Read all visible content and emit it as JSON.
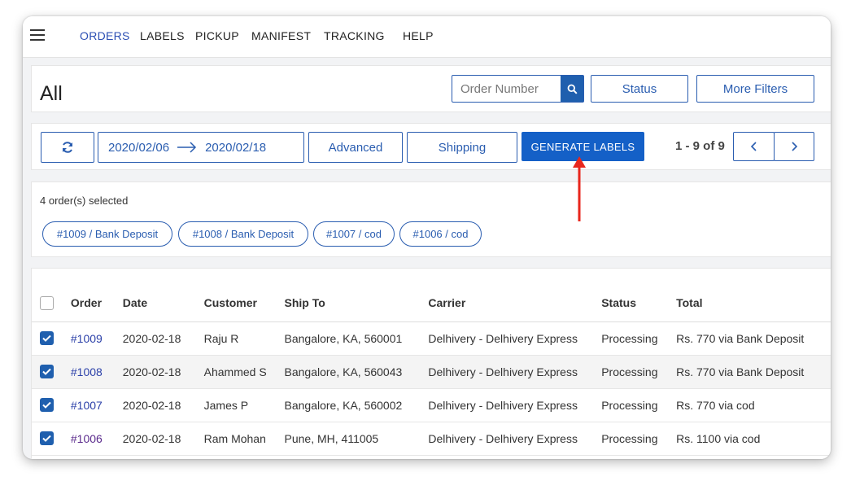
{
  "nav": {
    "menu_icon": "hamburger-menu-icon",
    "items": [
      {
        "label": "ORDERS",
        "active": true
      },
      {
        "label": "LABELS",
        "active": false
      },
      {
        "label": "PICKUP",
        "active": false
      },
      {
        "label": "MANIFEST",
        "active": false
      },
      {
        "label": "TRACKING",
        "active": false
      },
      {
        "label": "HELP",
        "active": false
      }
    ]
  },
  "header": {
    "title": "All",
    "search": {
      "placeholder": "Order Number",
      "value": "",
      "icon": "search-icon"
    },
    "status_label": "Status",
    "more_filters_label": "More Filters"
  },
  "toolbar": {
    "refresh_icon": "refresh-icon",
    "date_from": "2020/02/06",
    "date_to": "2020/02/18",
    "advanced_label": "Advanced",
    "shipping_label": "Shipping",
    "generate_labels_label": "GENERATE LABELS",
    "pager_text": "1 - 9 of 9",
    "prev_icon": "chevron-left-icon",
    "next_icon": "chevron-right-icon"
  },
  "selection": {
    "summary": "4 order(s) selected",
    "chips": [
      "#1009 / Bank Deposit",
      "#1008 / Bank Deposit",
      "#1007 / cod",
      "#1006 / cod"
    ]
  },
  "table": {
    "columns": [
      "Order",
      "Date",
      "Customer",
      "Ship To",
      "Carrier",
      "Status",
      "Total"
    ],
    "rows": [
      {
        "checked": true,
        "order": "#1009",
        "date": "2020-02-18",
        "customer": "Raju R",
        "ship_to": "Bangalore, KA, 560001",
        "carrier": "Delhivery - Delhivery Express",
        "status": "Processing",
        "total": "Rs. 770 via Bank Deposit"
      },
      {
        "checked": true,
        "order": "#1008",
        "date": "2020-02-18",
        "customer": "Ahammed S",
        "ship_to": "Bangalore, KA, 560043",
        "carrier": "Delhivery - Delhivery Express",
        "status": "Processing",
        "total": "Rs. 770 via Bank Deposit"
      },
      {
        "checked": true,
        "order": "#1007",
        "date": "2020-02-18",
        "customer": "James P",
        "ship_to": "Bangalore, KA, 560002",
        "carrier": "Delhivery - Delhivery Express",
        "status": "Processing",
        "total": "Rs. 770 via cod"
      },
      {
        "checked": true,
        "order": "#1006",
        "date": "2020-02-18",
        "customer": "Ram Mohan",
        "ship_to": "Pune, MH, 411005",
        "carrier": "Delhivery - Delhivery Express",
        "status": "Processing",
        "total": "Rs. 1100 via cod"
      }
    ]
  },
  "annotation": {
    "arrow_color": "#e8261c",
    "icon": "red-arrow-annotation-icon"
  }
}
